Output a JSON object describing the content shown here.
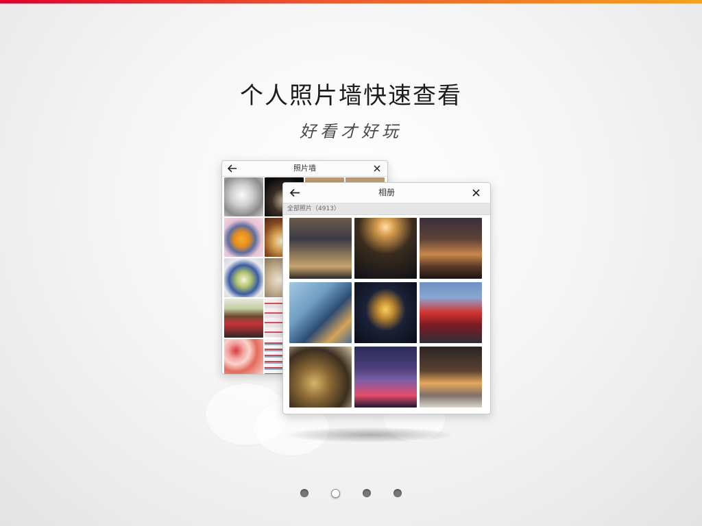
{
  "intro": {
    "headline": "个人照片墙快速查看",
    "tagline": "好看才好玩"
  },
  "photo_wall_window": {
    "title": "照片墙",
    "back_icon": "arrow-left-icon",
    "close_icon": "close-icon"
  },
  "album_window": {
    "title": "相册",
    "subtitle": "全部照片（4913）",
    "back_icon": "arrow-left-icon",
    "close_icon": "close-icon"
  },
  "pagination": {
    "total": 4,
    "active_index": 1
  },
  "colors": {
    "top_bar_start": "#e4002b",
    "top_bar_end": "#f7a21b"
  }
}
